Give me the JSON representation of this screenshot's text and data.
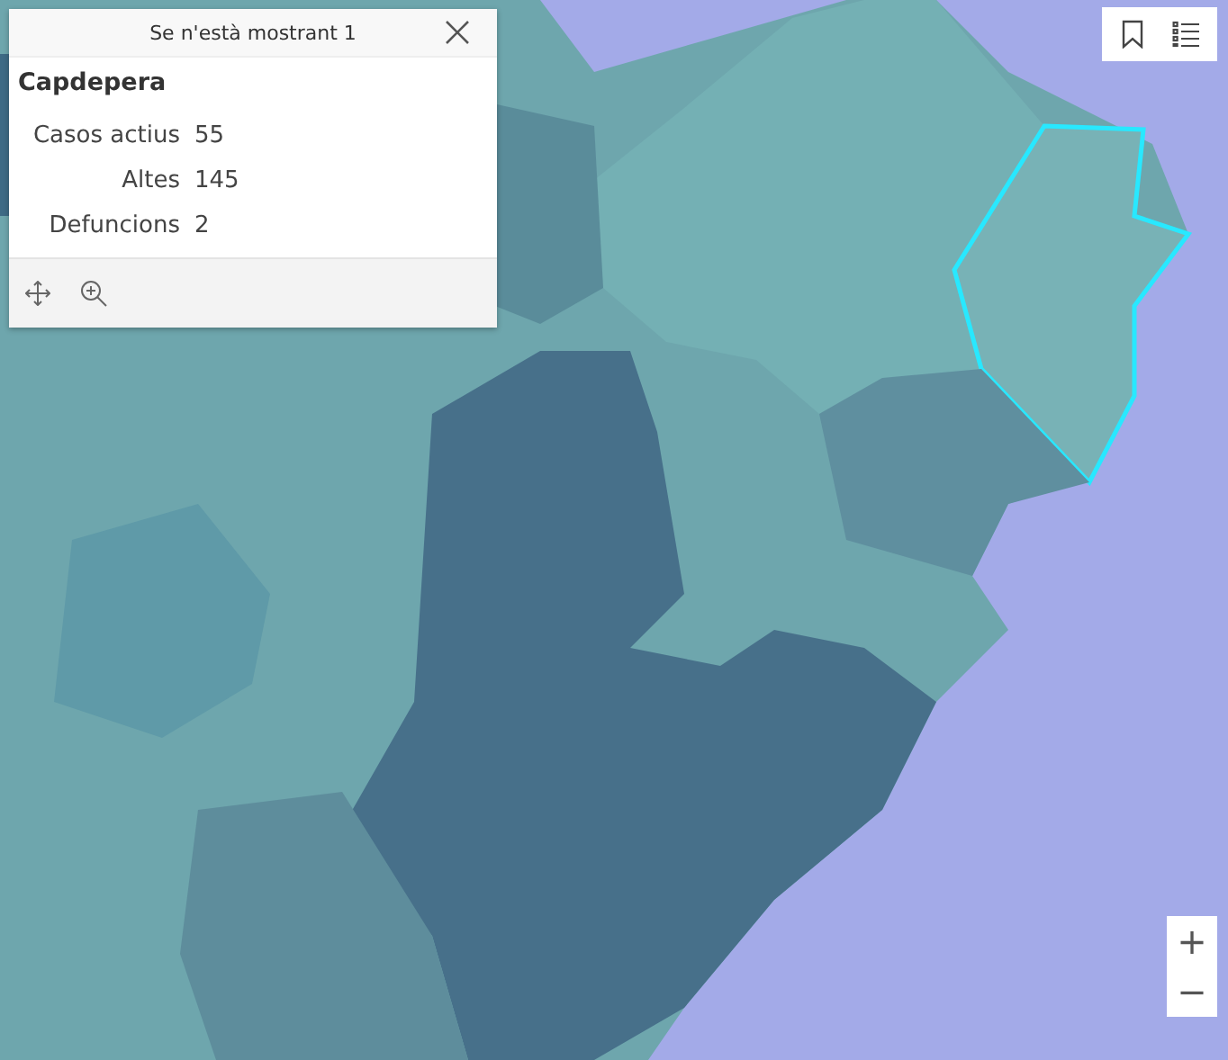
{
  "popup": {
    "header": "Se n'està mostrant 1",
    "title": "Capdepera",
    "fields": [
      {
        "label": "Casos actius",
        "value": "55"
      },
      {
        "label": "Altes",
        "value": "145"
      },
      {
        "label": "Defuncions",
        "value": "2"
      }
    ]
  },
  "zoom": {
    "zoom_in": "+",
    "zoom_out": "−"
  }
}
